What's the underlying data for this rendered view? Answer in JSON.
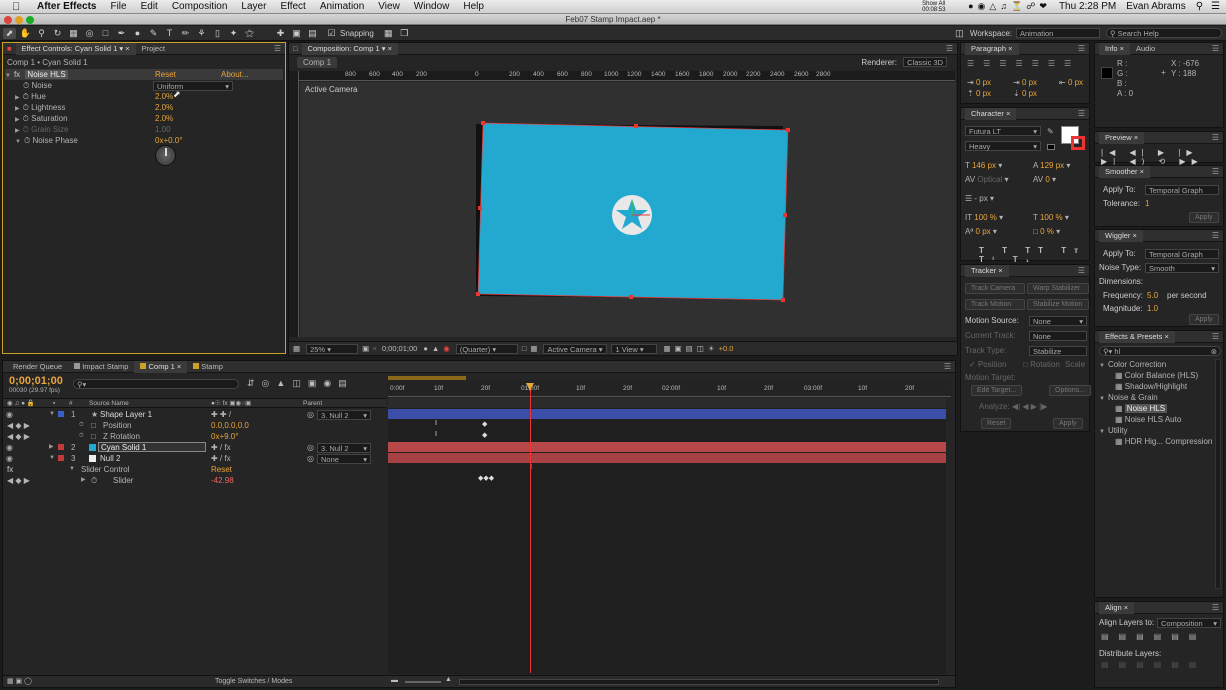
{
  "menubar": {
    "app": "After Effects",
    "items": [
      "File",
      "Edit",
      "Composition",
      "Layer",
      "Effect",
      "Animation",
      "View",
      "Window",
      "Help"
    ],
    "status": "Show All 00:08:53",
    "clock": "Thu 2:28 PM",
    "user": "Evan Abrams"
  },
  "window_title": "Feb07 Stamp Impact.aep *",
  "toolbar": {
    "snapping": "Snapping",
    "workspace_label": "Workspace:",
    "workspace_value": "Animation",
    "search_placeholder": "Search Help"
  },
  "effect_controls": {
    "tab": "Effect Controls: Cyan Solid 1",
    "tab2": "Project",
    "crumb": "Comp 1 • Cyan Solid 1",
    "effect_name": "Noise HLS",
    "reset": "Reset",
    "about": "About...",
    "props": [
      {
        "name": "Noise",
        "value": "Uniform"
      },
      {
        "name": "Hue",
        "value": "2.0%"
      },
      {
        "name": "Lightness",
        "value": "2.0%"
      },
      {
        "name": "Saturation",
        "value": "2.0%"
      },
      {
        "name": "Grain Size",
        "value": "1.00"
      },
      {
        "name": "Noise Phase",
        "value": "0x+0.0°"
      }
    ]
  },
  "composition": {
    "tab": "Composition: Comp 1",
    "crumb": "Comp 1",
    "renderer_label": "Renderer:",
    "renderer": "Classic 3D",
    "view_label": "Active Camera",
    "ruler": [
      "800",
      "600",
      "400",
      "200",
      "0",
      "200",
      "400",
      "600",
      "800",
      "1000",
      "1200",
      "1400",
      "1600",
      "1800",
      "2000",
      "2200",
      "2400",
      "2600",
      "2800"
    ],
    "footer": {
      "zoom": "25%",
      "time": "0;00;01;00",
      "resolution": "(Quarter)",
      "camera": "Active Camera",
      "views": "1 View",
      "exposure": "+0.0"
    }
  },
  "timeline": {
    "tabs": [
      "Render Queue",
      "Impact Stamp",
      "Comp 1",
      "Stamp"
    ],
    "timecode": "0;00;01;00",
    "frames": "00030 (29.97 fps)",
    "col_num": "#",
    "col_source": "Source Name",
    "col_parent": "Parent",
    "ruler": [
      "0:00f",
      "10f",
      "20f",
      "01:00f",
      "10f",
      "20f",
      "02:00f",
      "10f",
      "20f",
      "03:00f",
      "10f",
      "20f"
    ],
    "layers": [
      {
        "num": "1",
        "name": "Shape Layer 1",
        "parent": "3. Null 2",
        "color": "#3a5fc4"
      },
      {
        "sub": "Position",
        "value": "0.0,0.0,0.0"
      },
      {
        "sub": "Z Rotation",
        "value": "0x+9.0°"
      },
      {
        "num": "2",
        "name": "Cyan Solid 1",
        "parent": "3. Null 2",
        "color": "#c23a3a"
      },
      {
        "num": "3",
        "name": "Null 2",
        "parent": "None",
        "color": "#c23a3a"
      },
      {
        "sub": "Slider Control",
        "value": "Reset"
      },
      {
        "sub": "Slider",
        "value": "-42.98"
      }
    ],
    "footer": "Toggle Switches / Modes"
  },
  "paragraph": {
    "tab": "Paragraph",
    "values": [
      "0 px",
      "0 px",
      "0 px",
      "0 px",
      "0 px"
    ]
  },
  "character": {
    "tab": "Character",
    "font": "Futura LT",
    "style": "Heavy",
    "size": "146 px",
    "leading": "129 px",
    "kerning": "Optical",
    "tracking": "0",
    "stroke": "- px",
    "vscale": "100 %",
    "hscale": "100 %",
    "baseline": "0 px",
    "tsume": "0 %"
  },
  "tracker": {
    "tab": "Tracker",
    "track_camera": "Track Camera",
    "warp": "Warp Stabilizer",
    "track_motion": "Track Motion",
    "stabilize": "Stabilize Motion",
    "motion_source_label": "Motion Source:",
    "motion_source": "None",
    "current_track_label": "Current Track:",
    "current_track": "None",
    "track_type_label": "Track Type:",
    "track_type": "Stabilize",
    "position": "Position",
    "rotation": "Rotation",
    "scale": "Scale",
    "motion_target": "Motion Target:",
    "edit_target": "Edit Target...",
    "options": "Options...",
    "analyze": "Analyze:",
    "reset": "Reset",
    "apply": "Apply"
  },
  "info": {
    "tab": "Info",
    "tab2": "Audio",
    "r": "R :",
    "g": "G :",
    "b": "B :",
    "a": "A : 0",
    "x": "X : -676",
    "y": "Y : 188"
  },
  "preview": {
    "tab": "Preview"
  },
  "smoother": {
    "tab": "Smoother",
    "apply_to_label": "Apply To:",
    "apply_to": "Temporal Graph",
    "tolerance_label": "Tolerance:",
    "tolerance": "1",
    "apply": "Apply"
  },
  "wiggler": {
    "tab": "Wiggler",
    "apply_to_label": "Apply To:",
    "apply_to": "Temporal Graph",
    "noise_label": "Noise Type:",
    "noise": "Smooth",
    "dims_label": "Dimensions:",
    "freq_label": "Frequency:",
    "freq": "5.0",
    "freq_unit": "per second",
    "mag_label": "Magnitude:",
    "mag": "1.0",
    "apply": "Apply"
  },
  "effects_presets": {
    "tab": "Effects & Presets",
    "search": "hl",
    "tree": [
      {
        "label": "Color Correction",
        "level": 0
      },
      {
        "label": "Color Balance (HLS)",
        "level": 1
      },
      {
        "label": "Shadow/Highlight",
        "level": 1
      },
      {
        "label": "Noise & Grain",
        "level": 0
      },
      {
        "label": "Noise HLS",
        "level": 1,
        "hl": true
      },
      {
        "label": "Noise HLS Auto",
        "level": 1
      },
      {
        "label": "Utility",
        "level": 0
      },
      {
        "label": "HDR Hig... Compression",
        "level": 1
      }
    ]
  },
  "align": {
    "tab": "Align",
    "align_to_label": "Align Layers to:",
    "align_to": "Composition",
    "distribute": "Distribute Layers:"
  }
}
